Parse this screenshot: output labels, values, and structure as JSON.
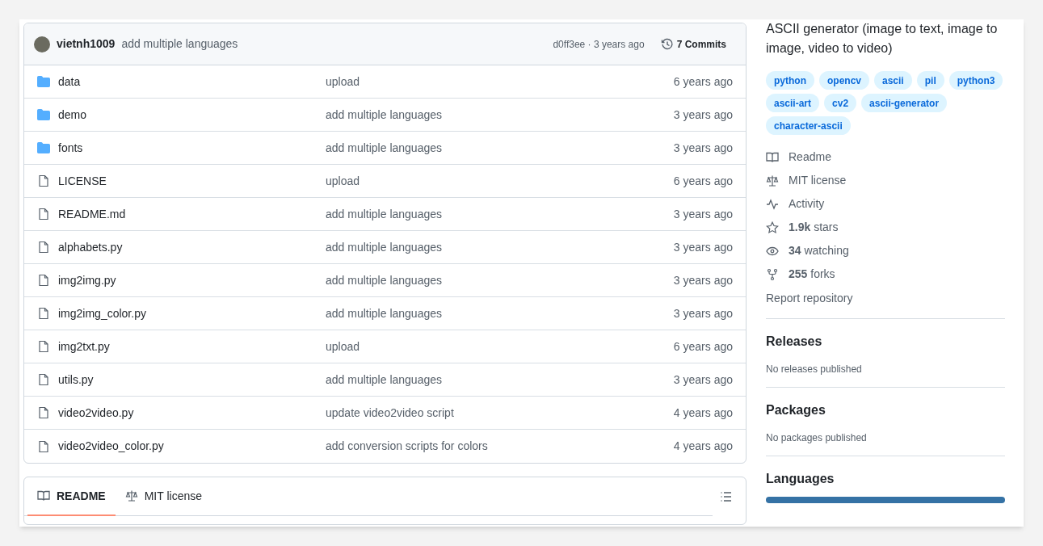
{
  "commit_header": {
    "author": "vietnh1009",
    "message": "add multiple languages",
    "hash_time": "d0ff3ee · 3 years ago",
    "commits": "7 Commits"
  },
  "files": [
    {
      "kind": "folder",
      "name": "data",
      "message": "upload",
      "time": "6 years ago"
    },
    {
      "kind": "folder",
      "name": "demo",
      "message": "add multiple languages",
      "time": "3 years ago"
    },
    {
      "kind": "folder",
      "name": "fonts",
      "message": "add multiple languages",
      "time": "3 years ago"
    },
    {
      "kind": "file",
      "name": "LICENSE",
      "message": "upload",
      "time": "6 years ago"
    },
    {
      "kind": "file",
      "name": "README.md",
      "message": "add multiple languages",
      "time": "3 years ago"
    },
    {
      "kind": "file",
      "name": "alphabets.py",
      "message": "add multiple languages",
      "time": "3 years ago"
    },
    {
      "kind": "file",
      "name": "img2img.py",
      "message": "add multiple languages",
      "time": "3 years ago"
    },
    {
      "kind": "file",
      "name": "img2img_color.py",
      "message": "add multiple languages",
      "time": "3 years ago"
    },
    {
      "kind": "file",
      "name": "img2txt.py",
      "message": "upload",
      "time": "6 years ago"
    },
    {
      "kind": "file",
      "name": "utils.py",
      "message": "add multiple languages",
      "time": "3 years ago"
    },
    {
      "kind": "file",
      "name": "video2video.py",
      "message": "update video2video script",
      "time": "4 years ago"
    },
    {
      "kind": "file",
      "name": "video2video_color.py",
      "message": "add conversion scripts for colors",
      "time": "4 years ago"
    }
  ],
  "readme_tabs": [
    {
      "kind": "readme",
      "label": "README",
      "selected": true
    },
    {
      "kind": "license",
      "label": "MIT license",
      "selected": false
    }
  ],
  "about": {
    "description": "ASCII generator (image to text, image to image, video to video)",
    "topics": [
      "python",
      "opencv",
      "ascii",
      "pil",
      "python3",
      "ascii-art",
      "cv2",
      "ascii-generator",
      "character-ascii"
    ],
    "links": [
      {
        "kind": "readme",
        "text": "Readme"
      },
      {
        "kind": "license",
        "text": "MIT license"
      },
      {
        "kind": "activity",
        "text": "Activity"
      },
      {
        "kind": "stars",
        "text": "**1.9k** stars"
      },
      {
        "kind": "watching",
        "text": "**34** watching"
      },
      {
        "kind": "forks",
        "text": "**255** forks"
      }
    ],
    "report": "Report repository"
  },
  "releases": {
    "title": "Releases",
    "note": "No releases published"
  },
  "packages": {
    "title": "Packages",
    "note": "No packages published"
  },
  "languages": {
    "title": "Languages",
    "segments": [
      {
        "color": "#3572a5",
        "level": 1
      }
    ]
  }
}
